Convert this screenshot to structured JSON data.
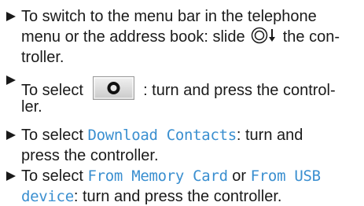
{
  "steps": [
    {
      "line1": "To switch to the menu bar in the telephone",
      "line2a": "menu or the address book: slide",
      "line2b": "the con-",
      "line3": "troller.",
      "icon": "controller-slide-down-icon"
    },
    {
      "line1a": "To select",
      "line1b": ": turn and press the control-",
      "line2": "ler.",
      "icon": "menu-symbol-button-icon"
    },
    {
      "line1a": "To select",
      "term": "Download Contacts",
      "line1b": ": turn and",
      "line2": "press the controller."
    },
    {
      "line1a": "To select",
      "term1": "From Memory Card",
      "or": "or",
      "term2a": "From USB",
      "term2b": "device",
      "line2": ": turn and press the controller."
    }
  ],
  "colors": {
    "text": "#1a1a1a",
    "term": "#3a8fd0"
  }
}
